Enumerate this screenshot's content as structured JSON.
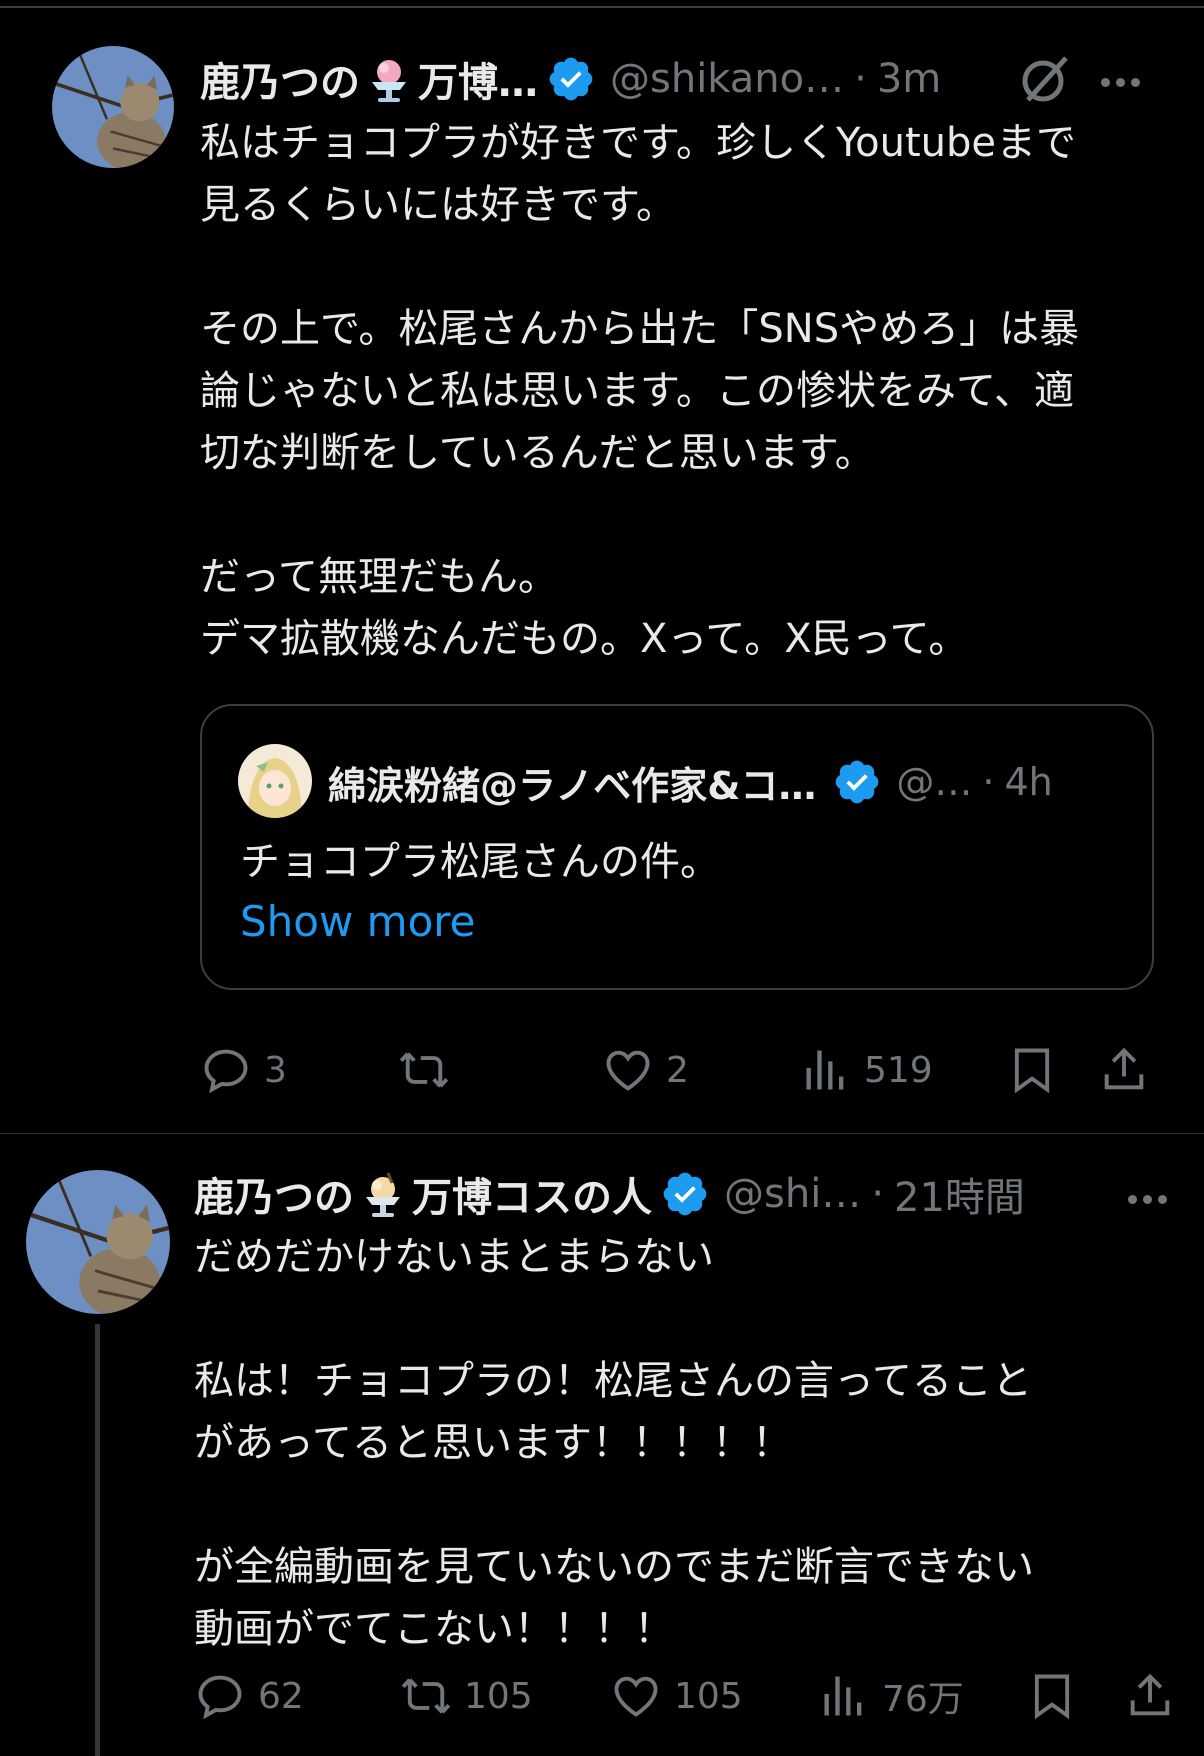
{
  "tweets": [
    {
      "author_name": "鹿乃つの",
      "author_name_suffix": "万博…",
      "handle": "@shikano…",
      "time": "3m",
      "text": "私はチョコプラが好きです。珍しくYoutubeまで\n見るくらいには好きです。\n\nその上で。松尾さんから出た「SNSやめろ」は暴\n論じゃないと私は思います。この惨状をみて、適\n切な判断をしているんだと思います。\n\nだって無理だもん。\nデマ拡散機なんだもの。Xって。X民って。",
      "quote": {
        "author_name": "綿涙粉緒@ラノベ作家&コ…",
        "handle": "@…",
        "time": "4h",
        "text": "チョコプラ松尾さんの件。",
        "show_more": "Show more"
      },
      "actions": {
        "replies": "3",
        "reposts": "",
        "likes": "2",
        "views": "519"
      }
    },
    {
      "author_name": "鹿乃つの",
      "author_name_suffix": "万博コスの人",
      "handle": "@shi…",
      "time": "21時間",
      "text": "だめだかけないまとまらない\n\n私は！チョコプラの！松尾さんの言ってること\nがあってると思います！！！！！\n\nが全編動画を見ていないのでまだ断言できない\n動画がでてこない！！！！",
      "actions": {
        "replies": "62",
        "reposts": "105",
        "likes": "105",
        "views": "76万"
      }
    }
  ],
  "icons": {
    "verified": "verified-badge-icon",
    "grok": "grok-icon",
    "more": "more-icon",
    "reply": "reply-icon",
    "repost": "repost-icon",
    "like": "like-icon",
    "views": "views-icon",
    "bookmark": "bookmark-icon",
    "share": "share-icon"
  },
  "colors": {
    "background": "#000000",
    "text": "#e7e9ea",
    "secondary": "#71767b",
    "link": "#1d9bf0",
    "verified": "#1d9bf0"
  }
}
